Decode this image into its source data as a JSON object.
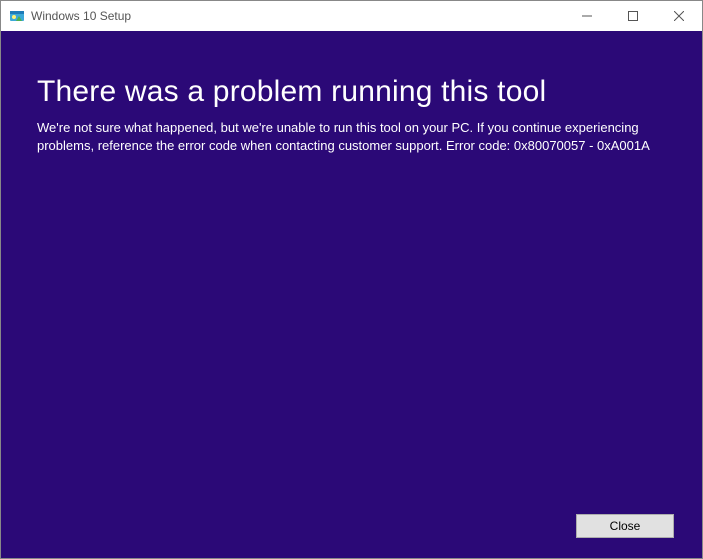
{
  "titlebar": {
    "title": "Windows 10 Setup"
  },
  "content": {
    "heading": "There was a problem running this tool",
    "body": "We're not sure what happened, but we're unable to run this tool on your PC. If you continue experiencing problems, reference the error code when contacting customer support. Error code: 0x80070057 - 0xA001A"
  },
  "footer": {
    "close_label": "Close"
  }
}
